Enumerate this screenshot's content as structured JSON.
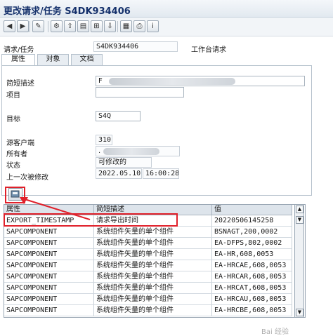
{
  "window": {
    "title": "更改请求/任务 S4DK934406"
  },
  "toolbar": {
    "buttons": [
      {
        "name": "back-icon",
        "glyph": "◀"
      },
      {
        "name": "forward-icon",
        "glyph": "▶"
      },
      {
        "name": "edit-icon",
        "glyph": "✎"
      },
      {
        "name": "transport-icon",
        "glyph": "⚙"
      },
      {
        "name": "release-icon",
        "glyph": "⇧"
      },
      {
        "name": "object-list-icon",
        "glyph": "▤"
      },
      {
        "name": "tree-icon",
        "glyph": "⊞"
      },
      {
        "name": "download-icon",
        "glyph": "⇩"
      },
      {
        "name": "display-icon",
        "glyph": "▦"
      },
      {
        "name": "print-icon",
        "glyph": "⎙"
      },
      {
        "name": "info-icon",
        "glyph": "i"
      }
    ]
  },
  "header": {
    "request_label": "请求/任务",
    "request_value": "S4DK934406",
    "workbench_label": "工作台请求"
  },
  "tabs": [
    "属性",
    "对象",
    "文档"
  ],
  "attributes": {
    "short_desc_label": "简短描述",
    "short_desc_value": "F",
    "project_label": "项目",
    "target_label": "目标",
    "target_value": "S4Q",
    "source_client_label": "源客户端",
    "source_client_value": "310",
    "owner_label": "所有者",
    "owner_value": ".",
    "status_label": "状态",
    "status_value": "可修改的",
    "last_changed_label": "上一次被修改",
    "last_changed_date": "2022.05.10",
    "last_changed_time": "16:00:28"
  },
  "table": {
    "columns": [
      "属性",
      "简短描述",
      "值"
    ],
    "rows": [
      {
        "attr": "EXPORT_TIMESTAMP",
        "desc": "请求导出时间",
        "value": "20220506145258"
      },
      {
        "attr": "SAPCOMPONENT",
        "desc": "系统组件矢量的单个组件",
        "value": "BSNAGT,200,0002"
      },
      {
        "attr": "SAPCOMPONENT",
        "desc": "系统组件矢量的单个组件",
        "value": "EA-DFPS,802,0002"
      },
      {
        "attr": "SAPCOMPONENT",
        "desc": "系统组件矢量的单个组件",
        "value": "EA-HR,608,0053"
      },
      {
        "attr": "SAPCOMPONENT",
        "desc": "系统组件矢量的单个组件",
        "value": "EA-HRCAE,608,0053"
      },
      {
        "attr": "SAPCOMPONENT",
        "desc": "系统组件矢量的单个组件",
        "value": "EA-HRCAR,608,0053"
      },
      {
        "attr": "SAPCOMPONENT",
        "desc": "系统组件矢量的单个组件",
        "value": "EA-HRCAT,608,0053"
      },
      {
        "attr": "SAPCOMPONENT",
        "desc": "系统组件矢量的单个组件",
        "value": "EA-HRCAU,608,0053"
      },
      {
        "attr": "SAPCOMPONENT",
        "desc": "系统组件矢量的单个组件",
        "value": "EA-HRCBE,608,0053"
      }
    ]
  },
  "watermark": "Bai 经验",
  "colors": {
    "highlight": "#e0202a",
    "title": "#14306b"
  }
}
